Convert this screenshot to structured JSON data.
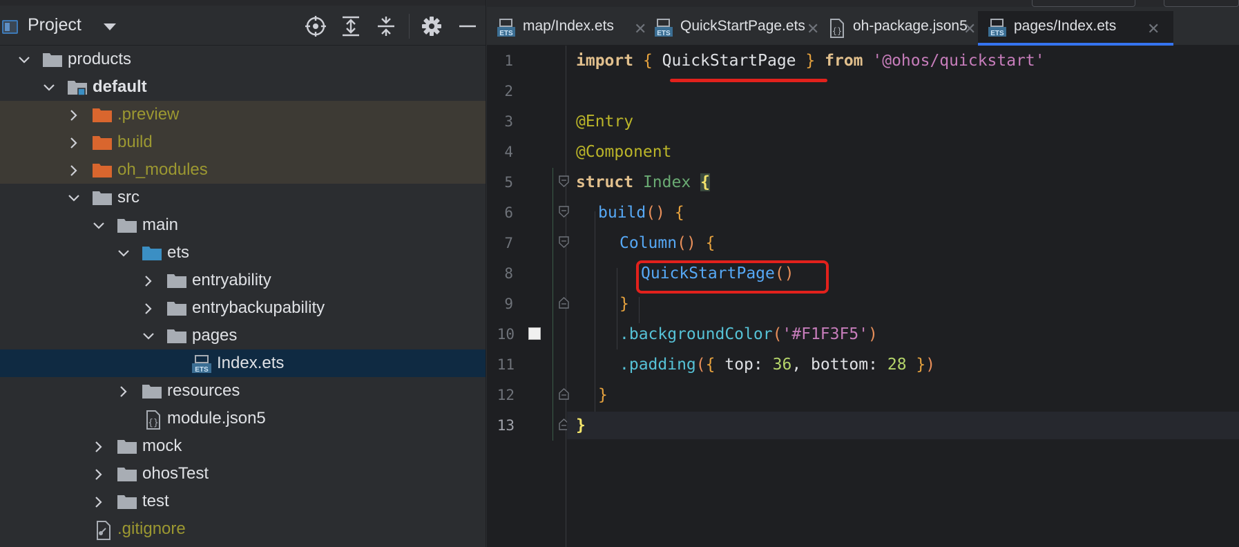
{
  "project_panel": {
    "title": "Project",
    "tree": [
      {
        "label": "products",
        "level": 0,
        "expanded": true,
        "kind": "folder",
        "excluded": false
      },
      {
        "label": "default",
        "level": 1,
        "expanded": true,
        "kind": "module",
        "excluded": false
      },
      {
        "label": ".preview",
        "level": 2,
        "expanded": false,
        "kind": "folder-excluded",
        "excluded": true
      },
      {
        "label": "build",
        "level": 2,
        "expanded": false,
        "kind": "folder-excluded",
        "excluded": true
      },
      {
        "label": "oh_modules",
        "level": 2,
        "expanded": false,
        "kind": "folder-excluded",
        "excluded": true
      },
      {
        "label": "src",
        "level": 2,
        "expanded": true,
        "kind": "folder",
        "excluded": false
      },
      {
        "label": "main",
        "level": 3,
        "expanded": true,
        "kind": "folder",
        "excluded": false
      },
      {
        "label": "ets",
        "level": 4,
        "expanded": true,
        "kind": "folder-source",
        "excluded": false
      },
      {
        "label": "entryability",
        "level": 5,
        "expanded": false,
        "kind": "folder",
        "excluded": false
      },
      {
        "label": "entrybackupability",
        "level": 5,
        "expanded": false,
        "kind": "folder",
        "excluded": false
      },
      {
        "label": "pages",
        "level": 5,
        "expanded": true,
        "kind": "folder",
        "excluded": false
      },
      {
        "label": "Index.ets",
        "level": 6,
        "expanded": null,
        "kind": "ets-file",
        "excluded": false,
        "selected": true
      },
      {
        "label": "resources",
        "level": 4,
        "expanded": false,
        "kind": "folder",
        "excluded": false
      },
      {
        "label": "module.json5",
        "level": 4,
        "expanded": null,
        "kind": "json-file",
        "excluded": false
      },
      {
        "label": "mock",
        "level": 3,
        "expanded": false,
        "kind": "folder",
        "excluded": false
      },
      {
        "label": "ohosTest",
        "level": 3,
        "expanded": false,
        "kind": "folder",
        "excluded": false
      },
      {
        "label": "test",
        "level": 3,
        "expanded": false,
        "kind": "folder",
        "excluded": false
      },
      {
        "label": ".gitignore",
        "level": 2,
        "expanded": null,
        "kind": "git-file",
        "excluded": true
      }
    ],
    "header_icons": [
      "locate-icon",
      "expand-all-icon",
      "collapse-all-icon",
      "gear-icon",
      "minimize-icon"
    ]
  },
  "tabs": [
    {
      "label": "map/Index.ets",
      "icon": "ets-file-icon",
      "active": false
    },
    {
      "label": "QuickStartPage.ets",
      "icon": "ets-file-icon",
      "active": false
    },
    {
      "label": "oh-package.json5",
      "icon": "json-file-icon",
      "active": false
    },
    {
      "label": "pages/Index.ets",
      "icon": "ets-file-icon",
      "active": true
    }
  ],
  "editor": {
    "line_numbers": [
      "1",
      "2",
      "3",
      "4",
      "5",
      "6",
      "7",
      "8",
      "9",
      "10",
      "11",
      "12",
      "13"
    ],
    "current_line": "13",
    "code": {
      "l1_import": "import",
      "l1_lbrace": "{",
      "l1_name": "QuickStartPage",
      "l1_rbrace": "}",
      "l1_from": "from",
      "l1_module": "'@ohos/quickstart'",
      "l3_entry": "@Entry",
      "l4_component": "@Component",
      "l5_struct": "struct",
      "l5_index": "Index",
      "l5_brace": "{",
      "l6_build": "build",
      "l6_parens": "()",
      "l6_brace": "{",
      "l7_column": "Column",
      "l7_parens": "()",
      "l7_brace": "{",
      "l8_call": "QuickStartPage",
      "l8_parens": "()",
      "l9_close": "}",
      "l10_method": ".backgroundColor",
      "l10_open": "(",
      "l10_value": "'#F1F3F5'",
      "l10_close": ")",
      "l11_method": ".padding",
      "l11_open": "(",
      "l11_lbrace": "{",
      "l11_top_key": "top",
      "l11_colon1": ":",
      "l11_top_val": "36",
      "l11_comma": ",",
      "l11_bottom_key": "bottom",
      "l11_colon2": ":",
      "l11_bottom_val": "28",
      "l11_rbrace": "}",
      "l11_close": ")",
      "l12_close": "}",
      "l13_close": "}"
    }
  },
  "colors": {
    "accent": "#3574f0",
    "annotation": "#e2211c",
    "excluded_text": "#9c9831"
  }
}
